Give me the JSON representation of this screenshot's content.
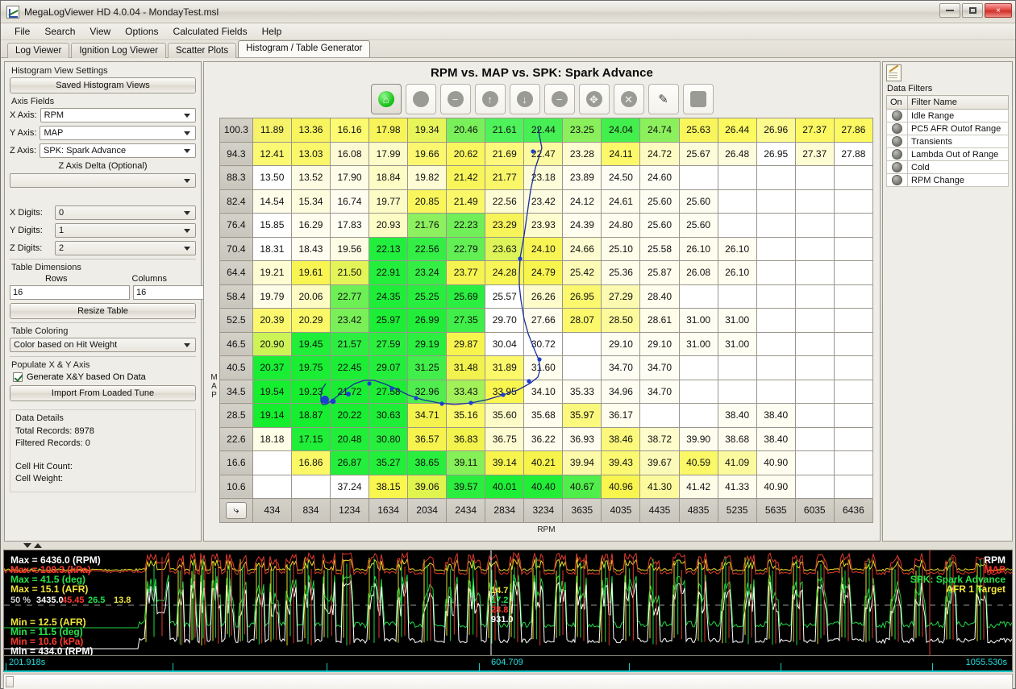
{
  "window": {
    "title": "MegaLogViewer HD 4.0.04 - MondayTest.msl",
    "app_icon": "chart-icon",
    "minimize": "minimize-icon",
    "maximize": "maximize-icon",
    "close": "×"
  },
  "menu": [
    "File",
    "Search",
    "View",
    "Options",
    "Calculated Fields",
    "Help"
  ],
  "tabs": [
    {
      "label": "Log Viewer",
      "active": false
    },
    {
      "label": "Ignition Log Viewer",
      "active": false
    },
    {
      "label": "Scatter Plots",
      "active": false
    },
    {
      "label": "Histogram / Table Generator",
      "active": true
    }
  ],
  "settings": {
    "panel_title": "Histogram View Settings",
    "saved_views_button": "Saved Histogram Views",
    "axis_fields_label": "Axis Fields",
    "x_axis_label": "X Axis:",
    "x_axis_value": "RPM",
    "y_axis_label": "Y Axis:",
    "y_axis_value": "MAP",
    "z_axis_label": "Z Axis:",
    "z_axis_value": "SPK: Spark Advance",
    "z_delta_label": "Z Axis Delta (Optional)",
    "z_delta_value": "",
    "x_digits_label": "X Digits:",
    "x_digits_value": "0",
    "y_digits_label": "Y Digits:",
    "y_digits_value": "1",
    "z_digits_label": "Z Digits:",
    "z_digits_value": "2",
    "table_dimensions_label": "Table Dimensions",
    "rows_label": "Rows",
    "columns_label": "Columns",
    "rows_value": "16",
    "columns_value": "16",
    "resize_button": "Resize Table",
    "table_coloring_label": "Table Coloring",
    "coloring_value": "Color based on Hit Weight",
    "populate_label": "Populate X & Y Axis",
    "generate_checkbox_label": "Generate X&Y based On Data",
    "generate_checked": true,
    "import_button": "Import From Loaded Tune",
    "data_details_label": "Data Details",
    "total_records": "Total Records: 8978",
    "filtered_records": "Filtered Records: 0",
    "cell_hit_count": "Cell Hit Count:",
    "cell_weight": "Cell Weight:"
  },
  "chart": {
    "title": "RPM vs. MAP vs. SPK: Spark Advance",
    "y_axis_caption": "MAP",
    "x_axis_caption": "RPM",
    "corner_button": "⤷",
    "toolbar": [
      {
        "name": "home-icon",
        "glyph": "⌂",
        "active": true
      },
      {
        "name": "circle-icon",
        "glyph": "",
        "active": false
      },
      {
        "name": "minus-circle-icon",
        "glyph": "−",
        "active": false
      },
      {
        "name": "arrow-up-icon",
        "glyph": "↑",
        "active": false
      },
      {
        "name": "arrow-down-icon",
        "glyph": "↓",
        "active": false
      },
      {
        "name": "subtract-icon",
        "glyph": "−",
        "active": false
      },
      {
        "name": "target-icon",
        "glyph": "✥",
        "active": false
      },
      {
        "name": "cancel-icon",
        "glyph": "✕",
        "active": false
      },
      {
        "name": "pencil-icon",
        "glyph": "✎",
        "active": false
      },
      {
        "name": "stop-square-icon",
        "glyph": "■",
        "active": false
      }
    ]
  },
  "chart_data": {
    "type": "heatmap",
    "title": "RPM vs. MAP vs. SPK: Spark Advance",
    "xlabel": "RPM",
    "ylabel": "MAP",
    "x_digits": 0,
    "y_digits": 1,
    "z_digits": 2,
    "legend": "Color based on Hit Weight",
    "categories": [
      "434",
      "834",
      "1234",
      "1634",
      "2034",
      "2434",
      "2834",
      "3234",
      "3635",
      "4035",
      "4435",
      "4835",
      "5235",
      "5635",
      "6035",
      "6436"
    ],
    "rows": [
      "100.3",
      "94.3",
      "88.3",
      "82.4",
      "76.4",
      "70.4",
      "64.4",
      "58.4",
      "52.5",
      "46.5",
      "40.5",
      "34.5",
      "28.5",
      "22.6",
      "16.6",
      "10.6"
    ],
    "values": [
      [
        "11.89",
        "13.36",
        "16.16",
        "17.98",
        "19.34",
        "20.46",
        "21.61",
        "22.44",
        "23.25",
        "24.04",
        "24.74",
        "25.63",
        "26.44",
        "26.96",
        "27.37",
        "27.86"
      ],
      [
        "12.41",
        "13.03",
        "16.08",
        "17.99",
        "19.66",
        "20.62",
        "21.69",
        "22.47",
        "23.28",
        "24.11",
        "24.72",
        "25.67",
        "26.48",
        "26.95",
        "27.37",
        "27.88"
      ],
      [
        "13.50",
        "13.52",
        "17.90",
        "18.84",
        "19.82",
        "21.42",
        "21.77",
        "23.18",
        "23.89",
        "24.50",
        "24.60",
        "",
        "",
        "",
        "",
        ""
      ],
      [
        "14.54",
        "15.34",
        "16.74",
        "19.77",
        "20.85",
        "21.49",
        "22.56",
        "23.42",
        "24.12",
        "24.61",
        "25.60",
        "25.60",
        "",
        "",
        "",
        ""
      ],
      [
        "15.85",
        "16.29",
        "17.83",
        "20.93",
        "21.76",
        "22.23",
        "23.29",
        "23.93",
        "24.39",
        "24.80",
        "25.60",
        "25.60",
        "",
        "",
        "",
        ""
      ],
      [
        "18.31",
        "18.43",
        "19.56",
        "22.13",
        "22.56",
        "22.79",
        "23.63",
        "24.10",
        "24.66",
        "25.10",
        "25.58",
        "26.10",
        "26.10",
        "",
        "",
        ""
      ],
      [
        "19.21",
        "19.61",
        "21.50",
        "22.91",
        "23.24",
        "23.77",
        "24.28",
        "24.79",
        "25.42",
        "25.36",
        "25.87",
        "26.08",
        "26.10",
        "",
        "",
        ""
      ],
      [
        "19.79",
        "20.06",
        "22.77",
        "24.35",
        "25.25",
        "25.69",
        "25.57",
        "26.26",
        "26.95",
        "27.29",
        "28.40",
        "",
        "",
        "",
        "",
        ""
      ],
      [
        "20.39",
        "20.29",
        "23.42",
        "25.97",
        "26.99",
        "27.35",
        "29.70",
        "27.66",
        "28.07",
        "28.50",
        "28.61",
        "31.00",
        "31.00",
        "",
        "",
        ""
      ],
      [
        "20.90",
        "19.45",
        "21.57",
        "27.59",
        "29.19",
        "29.87",
        "30.04",
        "30.72",
        "",
        "29.10",
        "29.10",
        "31.00",
        "31.00",
        "",
        "",
        ""
      ],
      [
        "20.37",
        "19.75",
        "22.45",
        "29.07",
        "31.25",
        "31.48",
        "31.89",
        "31.60",
        "",
        "34.70",
        "34.70",
        "",
        "",
        "",
        "",
        ""
      ],
      [
        "19.54",
        "19.23",
        "21.72",
        "27.58",
        "32.96",
        "33.43",
        "33.95",
        "34.10",
        "35.33",
        "34.96",
        "34.70",
        "",
        "",
        "",
        "",
        ""
      ],
      [
        "19.14",
        "18.87",
        "20.22",
        "30.63",
        "34.71",
        "35.16",
        "35.60",
        "35.68",
        "35.97",
        "36.17",
        "",
        "",
        "38.40",
        "38.40",
        "",
        ""
      ],
      [
        "18.18",
        "17.15",
        "20.48",
        "30.80",
        "36.57",
        "36.83",
        "36.75",
        "36.22",
        "36.93",
        "38.46",
        "38.72",
        "39.90",
        "38.68",
        "38.40",
        "",
        ""
      ],
      [
        "",
        "16.86",
        "26.87",
        "35.27",
        "38.65",
        "39.11",
        "39.14",
        "40.21",
        "39.94",
        "39.43",
        "39.67",
        "40.59",
        "41.09",
        "40.90",
        "",
        ""
      ],
      [
        "",
        "",
        "37.24",
        "38.15",
        "39.06",
        "39.57",
        "40.01",
        "40.40",
        "40.67",
        "40.96",
        "41.30",
        "41.42",
        "41.33",
        "40.90",
        "",
        ""
      ]
    ],
    "cell_colors": [
      [
        "#f6f36a",
        "#f7f45e",
        "#fbfa70",
        "#f7f45a",
        "#e8f55a",
        "#79f05a",
        "#4ef25a",
        "#46ef54",
        "#89f05c",
        "#42ef4c",
        "#8cf05c",
        "#f9f65c",
        "#fcfa5e",
        "#fdfb8e",
        "#fbf862",
        "#fbf862"
      ],
      [
        "#fbf872",
        "#faf76a",
        "#fbfad4",
        "#fdfbc8",
        "#fbf870",
        "#f9f65e",
        "#fbf87c",
        "#fcfaa0",
        "#fdfcd0",
        "#fbf86a",
        "#fcfac0",
        "#fdfcd8",
        "#fdfcdc",
        "#ffffff",
        "#fdfcd2",
        "#ffffff"
      ],
      [
        "#ffffff",
        "#fdfce2",
        "#fefde8",
        "#fdfcc4",
        "#fdfcd4",
        "#f8f55a",
        "#f9f66a",
        "#fdfcd8",
        "#fefdf0",
        "#fefdf4",
        "#fefdf4",
        "#ffffff",
        "#ffffff",
        "#ffffff",
        "#ffffff",
        "#ffffff"
      ],
      [
        "#fefdea",
        "#fdfcdc",
        "#fefdf0",
        "#fdfcc6",
        "#f9f65c",
        "#fbf868",
        "#fdfcd2",
        "#fdfce0",
        "#fefdee",
        "#fefdee",
        "#fefdf2",
        "#fefdf2",
        "#ffffff",
        "#ffffff",
        "#ffffff",
        "#ffffff"
      ],
      [
        "#ffffff",
        "#fefdee",
        "#fefdf2",
        "#fdfcc4",
        "#8df05e",
        "#70ef58",
        "#f7f45a",
        "#fdfcce",
        "#fefdee",
        "#fefdf0",
        "#fefdf2",
        "#fefdf2",
        "#ffffff",
        "#ffffff",
        "#ffffff",
        "#ffffff"
      ],
      [
        "#ffffff",
        "#fefdf0",
        "#fdfce4",
        "#22ee3e",
        "#34ee46",
        "#61ef54",
        "#dcf458",
        "#f7f454",
        "#fdfcd0",
        "#fefdea",
        "#fefdf0",
        "#fefdee",
        "#fefdf0",
        "#ffffff",
        "#ffffff",
        "#ffffff"
      ],
      [
        "#fdfcd2",
        "#f8f552",
        "#e4f458",
        "#23ee3c",
        "#35ee44",
        "#f5f350",
        "#f8f556",
        "#f7f44e",
        "#fcfab4",
        "#fefdea",
        "#fefdee",
        "#fefdee",
        "#fefdf0",
        "#ffffff",
        "#ffffff",
        "#ffffff"
      ],
      [
        "#fefde8",
        "#fdfcc2",
        "#6def56",
        "#1eee38",
        "#28ee3e",
        "#2aee40",
        "#ffffff",
        "#fdfcca",
        "#fbf86e",
        "#fcfab0",
        "#fefdee",
        "#ffffff",
        "#ffffff",
        "#ffffff",
        "#ffffff",
        "#ffffff"
      ],
      [
        "#fbf86e",
        "#fbf868",
        "#79f058",
        "#1cee36",
        "#22ee3a",
        "#3fee48",
        "#ffffff",
        "#fefdee",
        "#fbf86c",
        "#fcfa9a",
        "#fefde8",
        "#fefdf2",
        "#fefdf2",
        "#ffffff",
        "#ffffff",
        "#ffffff"
      ],
      [
        "#ccf456",
        "#20ee38",
        "#2dee40",
        "#2aee3e",
        "#2bee40",
        "#f7f44e",
        "#ffffff",
        "#ffffff",
        "#ffffff",
        "#fefdf2",
        "#fefdf2",
        "#fefdf2",
        "#fefdf2",
        "#ffffff",
        "#ffffff",
        "#ffffff"
      ],
      [
        "#1aee34",
        "#1aee34",
        "#1cee36",
        "#24ee3c",
        "#41ee4a",
        "#f1f24e",
        "#fbf86a",
        "#fefdee",
        "#ffffff",
        "#fefdf4",
        "#fefdf4",
        "#ffffff",
        "#ffffff",
        "#ffffff",
        "#ffffff",
        "#ffffff"
      ],
      [
        "#16ee30",
        "#16ee30",
        "#19ee34",
        "#1cee36",
        "#4fee4e",
        "#a2f158",
        "#f9f650",
        "#fefdee",
        "#fefdf0",
        "#fefdf2",
        "#fefdf4",
        "#ffffff",
        "#ffffff",
        "#ffffff",
        "#ffffff",
        "#ffffff"
      ],
      [
        "#14ee2e",
        "#16ee30",
        "#19ee32",
        "#1eee38",
        "#f4f34e",
        "#fbf86a",
        "#fdfcc8",
        "#fefdee",
        "#fbf87e",
        "#fefdee",
        "#ffffff",
        "#ffffff",
        "#fefdf2",
        "#fefdf2",
        "#ffffff",
        "#ffffff"
      ],
      [
        "#fefde6",
        "#21ee38",
        "#20ee38",
        "#28ee3e",
        "#f6f34e",
        "#f2f34c",
        "#fdfcd0",
        "#fefdee",
        "#fefdf0",
        "#fbf87c",
        "#fdfcca",
        "#fefdee",
        "#fefdf0",
        "#fefdf2",
        "#ffffff",
        "#ffffff"
      ],
      [
        "#ffffff",
        "#fbf866",
        "#24ee3c",
        "#23ee3a",
        "#2aee3e",
        "#85f058",
        "#f7f44e",
        "#f6f34c",
        "#fcfaa8",
        "#fbf872",
        "#fcfab8",
        "#fbf868",
        "#fcfa9e",
        "#fefdee",
        "#ffffff",
        "#ffffff"
      ],
      [
        "#ffffff",
        "#ffffff",
        "#ffffff",
        "#f9f64e",
        "#e0f44e",
        "#2bee3e",
        "#1fee36",
        "#22ee38",
        "#4fee4a",
        "#f8f54e",
        "#fcfa9c",
        "#fefde8",
        "#fefdee",
        "#fefdf0",
        "#ffffff",
        "#ffffff"
      ]
    ]
  },
  "filters": {
    "panel_icon": "notes-icon",
    "title": "Data Filters",
    "col_on": "On",
    "col_name": "Filter Name",
    "rows": [
      {
        "on": false,
        "name": "Idle Range"
      },
      {
        "on": false,
        "name": "PC5 AFR Outof Range"
      },
      {
        "on": false,
        "name": "Transients"
      },
      {
        "on": false,
        "name": "Lambda Out of Range"
      },
      {
        "on": false,
        "name": "Cold"
      },
      {
        "on": false,
        "name": "RPM Change"
      }
    ]
  },
  "graph": {
    "max_labels": [
      {
        "text": "Max = 6436.0 (RPM)",
        "color": "#ffffff"
      },
      {
        "text": "Max = 100.3 (kPa)",
        "color": "#ff3b30"
      },
      {
        "text": "Max = 41.5 (deg)",
        "color": "#24e24a"
      },
      {
        "text": "Max = 15.1 (AFR)",
        "color": "#f2e63a"
      }
    ],
    "min_labels": [
      {
        "text": "Min = 12.5 (AFR)",
        "color": "#f2e63a"
      },
      {
        "text": "Min = 11.5 (deg)",
        "color": "#24e24a"
      },
      {
        "text": "Min = 10.6 (kPa)",
        "color": "#ff3b30"
      },
      {
        "text": "Min = 434.0 (RPM)",
        "color": "#ffffff"
      }
    ],
    "left_cursor_values": [
      {
        "text": "50 %",
        "color": "#cfcfcf"
      },
      {
        "text": "3435.0",
        "color": "#ffffff"
      },
      {
        "text": "45.45",
        "color": "#ff3b30"
      },
      {
        "text": "26.5",
        "color": "#24e24a"
      },
      {
        "text": "13.8",
        "color": "#f2e63a"
      }
    ],
    "mid_cursor_values": [
      {
        "text": "14.7",
        "color": "#f2e63a"
      },
      {
        "text": "17.2",
        "color": "#24e24a"
      },
      {
        "text": "28.8",
        "color": "#ff3b30"
      },
      {
        "text": "931.0",
        "color": "#ffffff"
      }
    ],
    "legend": [
      {
        "text": "RPM",
        "color": "#ffffff"
      },
      {
        "text": "MAP",
        "color": "#ff2a20"
      },
      {
        "text": "SPK: Spark Advance",
        "color": "#24e24a"
      },
      {
        "text": "AFR 1 Target",
        "color": "#f2e63a"
      }
    ],
    "time_start": "201.918s",
    "time_mid": "604.709",
    "time_end": "1055.530s"
  }
}
